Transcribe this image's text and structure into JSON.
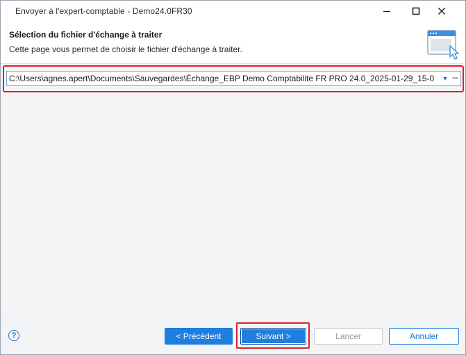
{
  "window": {
    "title": "Envoyer à l'expert-comptable - Demo24.0FR30"
  },
  "header": {
    "title": "Sélection du fichier d'échange à traiter",
    "subtitle": "Cette page vous permet de choisir le fichier d'échange à traiter."
  },
  "file_selector": {
    "value": "C:\\Users\\agnes.apert\\Documents\\Sauvegardes\\Échange_EBP Demo Comptabilite FR PRO 24.0_2025-01-29_15-0",
    "browse_label": "···"
  },
  "footer": {
    "help_label": "?",
    "prev_label": "< Précédent",
    "next_label": "Suivant >",
    "launch_label": "Lancer",
    "cancel_label": "Annuler"
  },
  "colors": {
    "accent": "#1f7ee0",
    "highlight": "#d9232d"
  }
}
